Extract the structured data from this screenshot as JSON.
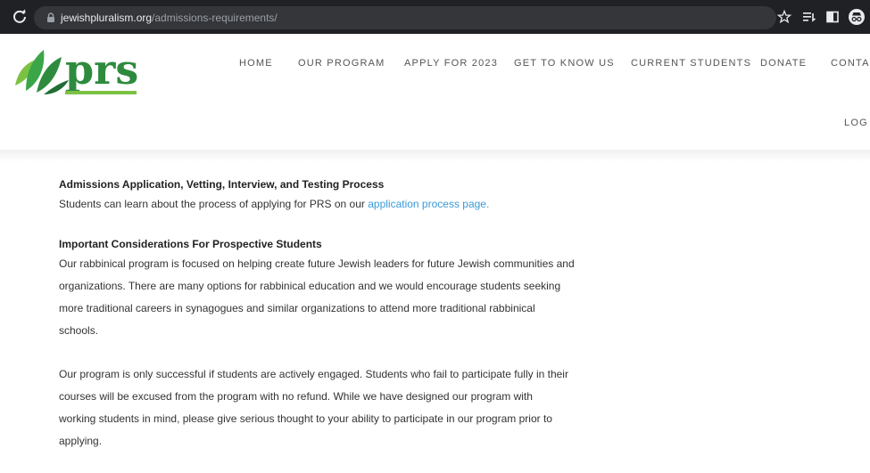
{
  "browser": {
    "url_domain": "jewishpluralism.org",
    "url_path": "/admissions-requirements/"
  },
  "site": {
    "logo_text": "prs",
    "nav": [
      "HOME",
      "OUR PROGRAM",
      "APPLY FOR 2023",
      "GET TO KNOW US",
      "CURRENT STUDENTS",
      "DONATE",
      "CONTACT"
    ],
    "login": "LOG IN"
  },
  "content": {
    "section1": {
      "heading": "Admissions Application, Vetting, Interview, and Testing Process",
      "text": "Students can learn about the process of applying for PRS on our ",
      "link": "application process page."
    },
    "section2": {
      "heading": "Important Considerations For Prospective Students",
      "para1_lines": [
        "Our rabbinical program is focused on helping create future Jewish leaders for future Jewish communities and",
        "organizations. There are many options for rabbinical education and we would encourage students seeking",
        "more traditional careers in synagogues and similar organizations to attend more traditional rabbinical",
        "schools."
      ],
      "para2_lines": [
        "Our program is only successful if students are actively engaged. Students who fail to participate fully in their",
        "courses will be excused from the program with no refund. While we have designed our program with",
        "working students in mind, please give serious thought to your ability to participate in our program prior to",
        "applying."
      ]
    }
  },
  "colors": {
    "chrome_bg": "#202124",
    "omnibox_bg": "#35363a",
    "logo_green": "#2e8b3e",
    "link": "#3a9ad9"
  }
}
